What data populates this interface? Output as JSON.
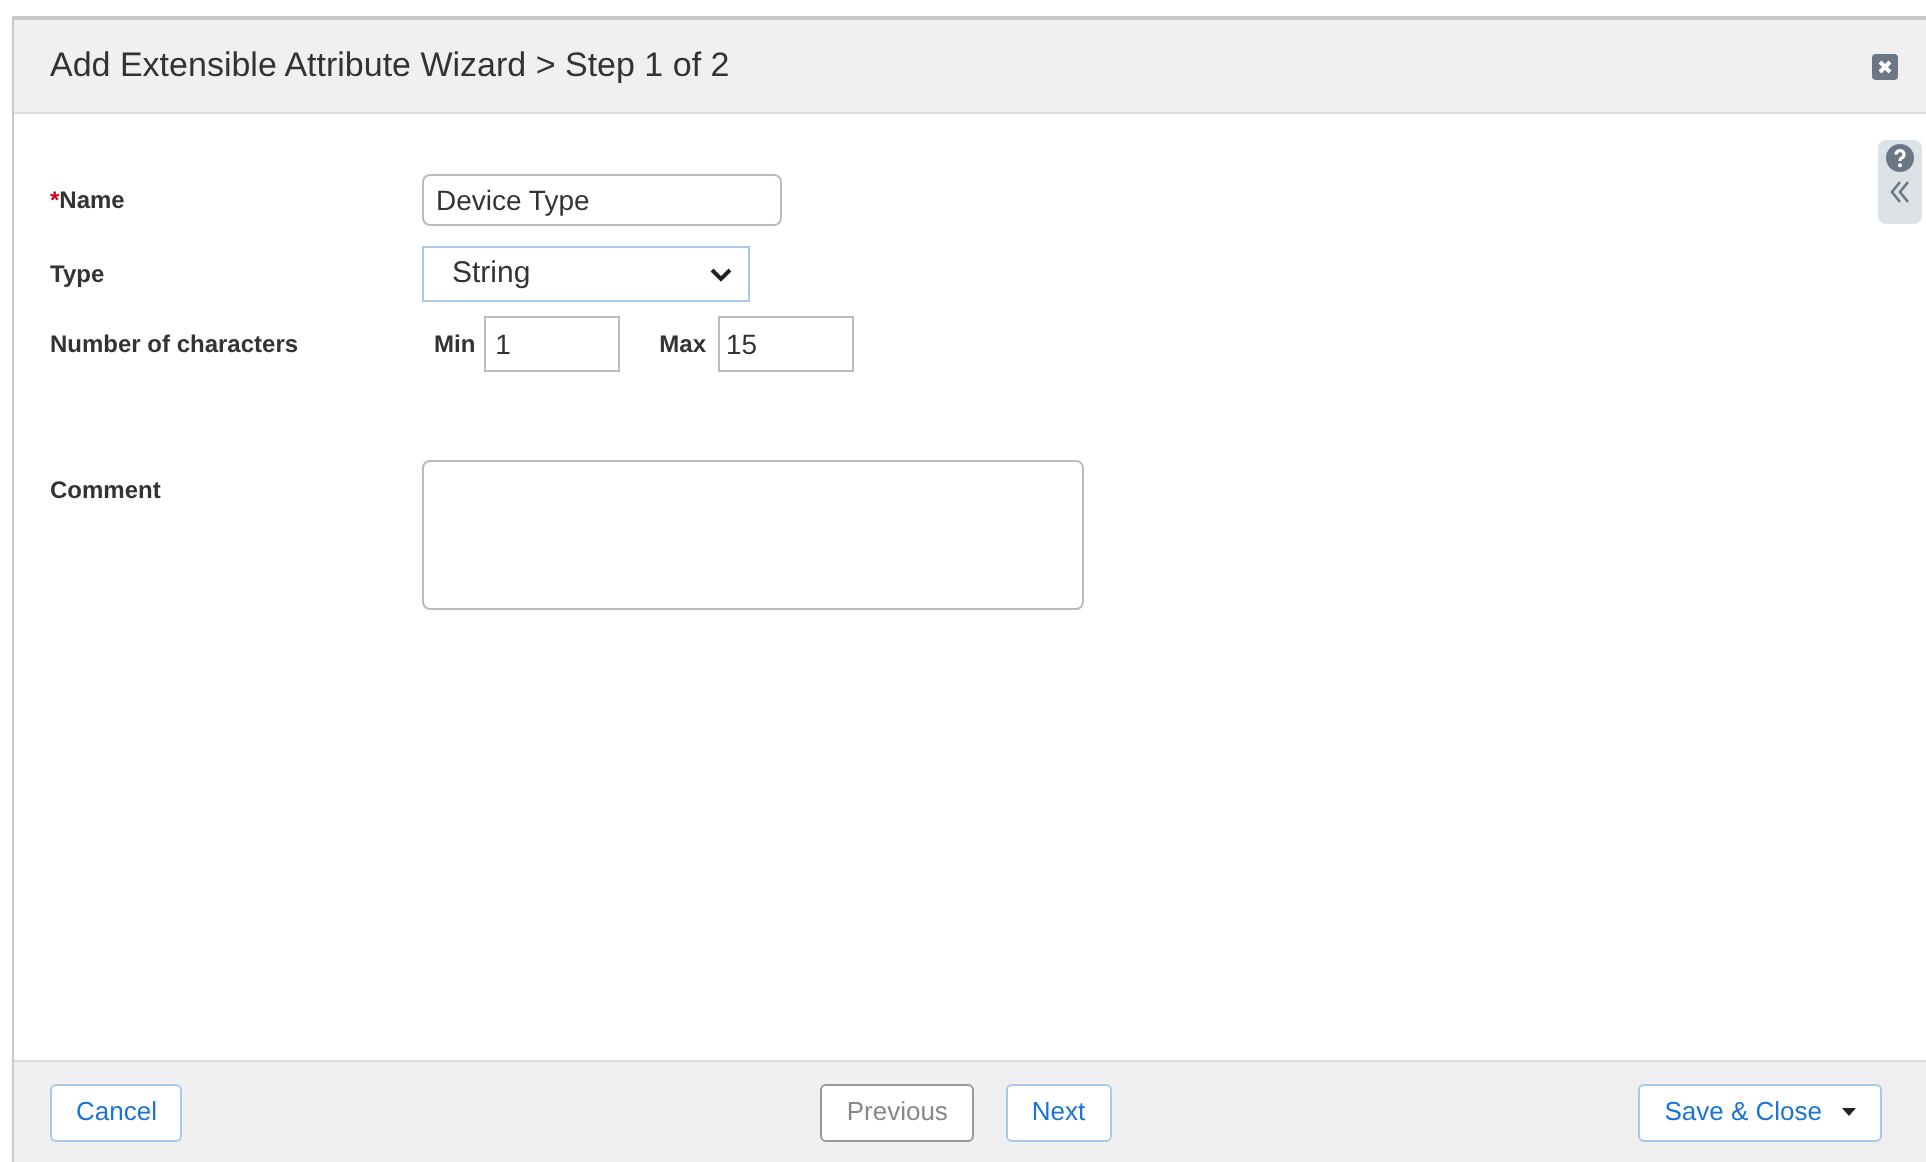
{
  "dialog": {
    "title": "Add Extensible Attribute Wizard > Step 1 of 2"
  },
  "form": {
    "name": {
      "required_mark": "*",
      "label": "Name",
      "value": "Device Type"
    },
    "type": {
      "label": "Type",
      "value": "String"
    },
    "characters": {
      "label": "Number of characters",
      "min_label": "Min",
      "min_value": "1",
      "max_label": "Max",
      "max_value": "15"
    },
    "comment": {
      "label": "Comment"
    }
  },
  "footer": {
    "buttons": [
      {
        "label": "Cancel",
        "kind": "cancel",
        "disabled": false
      },
      {
        "label": "Previous",
        "kind": "nav",
        "disabled": true
      },
      {
        "label": "Next",
        "kind": "nav",
        "disabled": false
      },
      {
        "label": "Save & Close",
        "kind": "split",
        "disabled": false
      }
    ]
  }
}
